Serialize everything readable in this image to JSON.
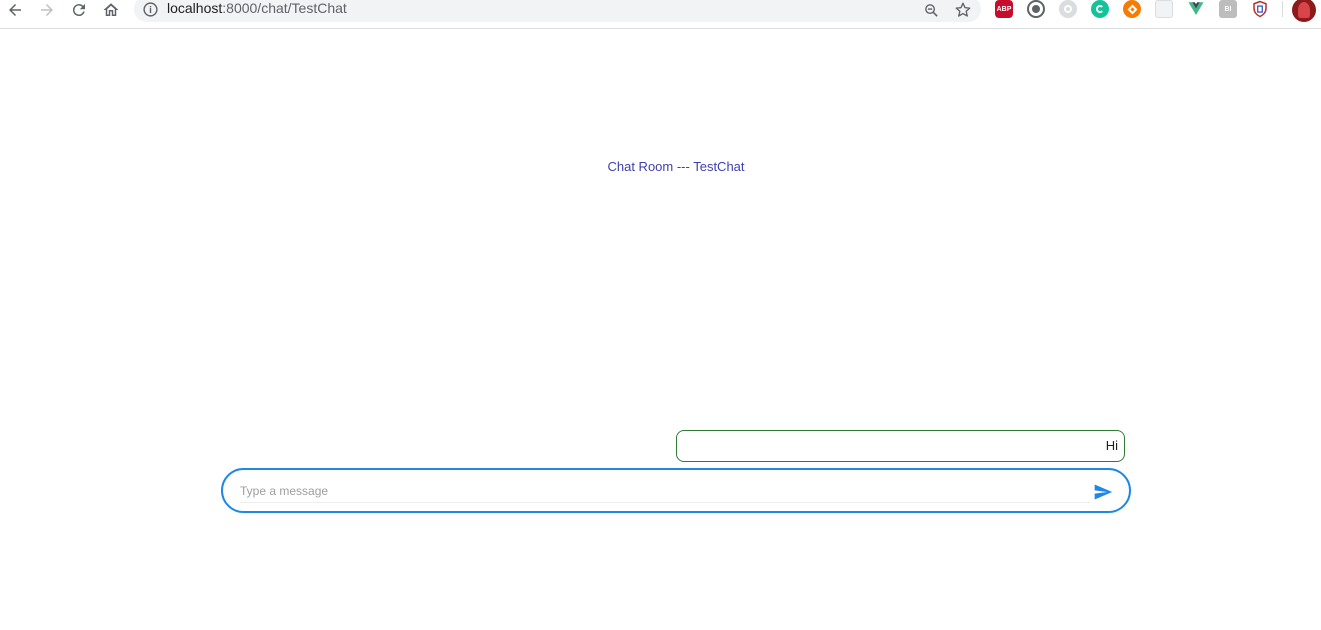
{
  "browser": {
    "url_host": "localhost",
    "url_rest": ":8000/chat/TestChat",
    "icons": [
      "back-icon",
      "forward-icon",
      "reload-icon",
      "home-icon",
      "info-icon",
      "zoom-out-icon",
      "bookmark-star-icon"
    ],
    "extensions": [
      {
        "name": "adblock-plus-icon",
        "label": "ABP",
        "color": "#c70d2c"
      },
      {
        "name": "dark-reader-icon",
        "label": "",
        "color": "#5f6368"
      },
      {
        "name": "extension-gear-icon",
        "label": "",
        "color": "#9aa0a6"
      },
      {
        "name": "grammarly-icon",
        "label": "",
        "color": "#15c39a"
      },
      {
        "name": "orange-extension-icon",
        "label": "",
        "color": "#f57c00"
      },
      {
        "name": "grid-extension-icon",
        "label": "",
        "color": "#e0e0e0"
      },
      {
        "name": "vue-devtools-icon",
        "label": "",
        "color": "#41b883"
      },
      {
        "name": "bi-extension-icon",
        "label": "BI",
        "color": "#9e9e9e"
      },
      {
        "name": "shield-extension-icon",
        "label": "",
        "color": "#c62828"
      }
    ]
  },
  "chat": {
    "title": "Chat Room --- TestChat",
    "messages": [
      {
        "text": "Hi"
      }
    ],
    "composer": {
      "placeholder": "Type a message",
      "value": ""
    },
    "accent_color": "#1e88e5",
    "message_border_color": "#2e7d32",
    "title_color": "#3f3fb0"
  }
}
